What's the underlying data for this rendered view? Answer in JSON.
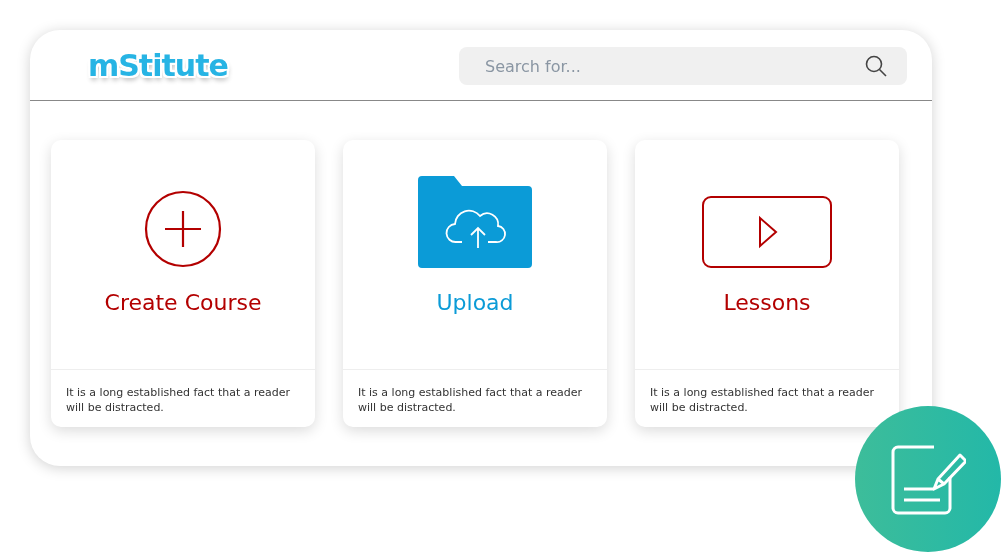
{
  "header": {
    "logo": "mStitute",
    "search": {
      "placeholder": "Search for..."
    }
  },
  "cards": [
    {
      "kind": "create",
      "title": "Create Course",
      "color": "#b30000",
      "description": "It is a long established fact that a reader will be distracted."
    },
    {
      "kind": "upload",
      "title": "Upload",
      "color": "#0b9bd7",
      "description": "It is a long established fact that a reader will be distracted."
    },
    {
      "kind": "lessons",
      "title": "Lessons",
      "color": "#b30000",
      "description": "It is a long established fact that a reader will be distracted."
    }
  ]
}
